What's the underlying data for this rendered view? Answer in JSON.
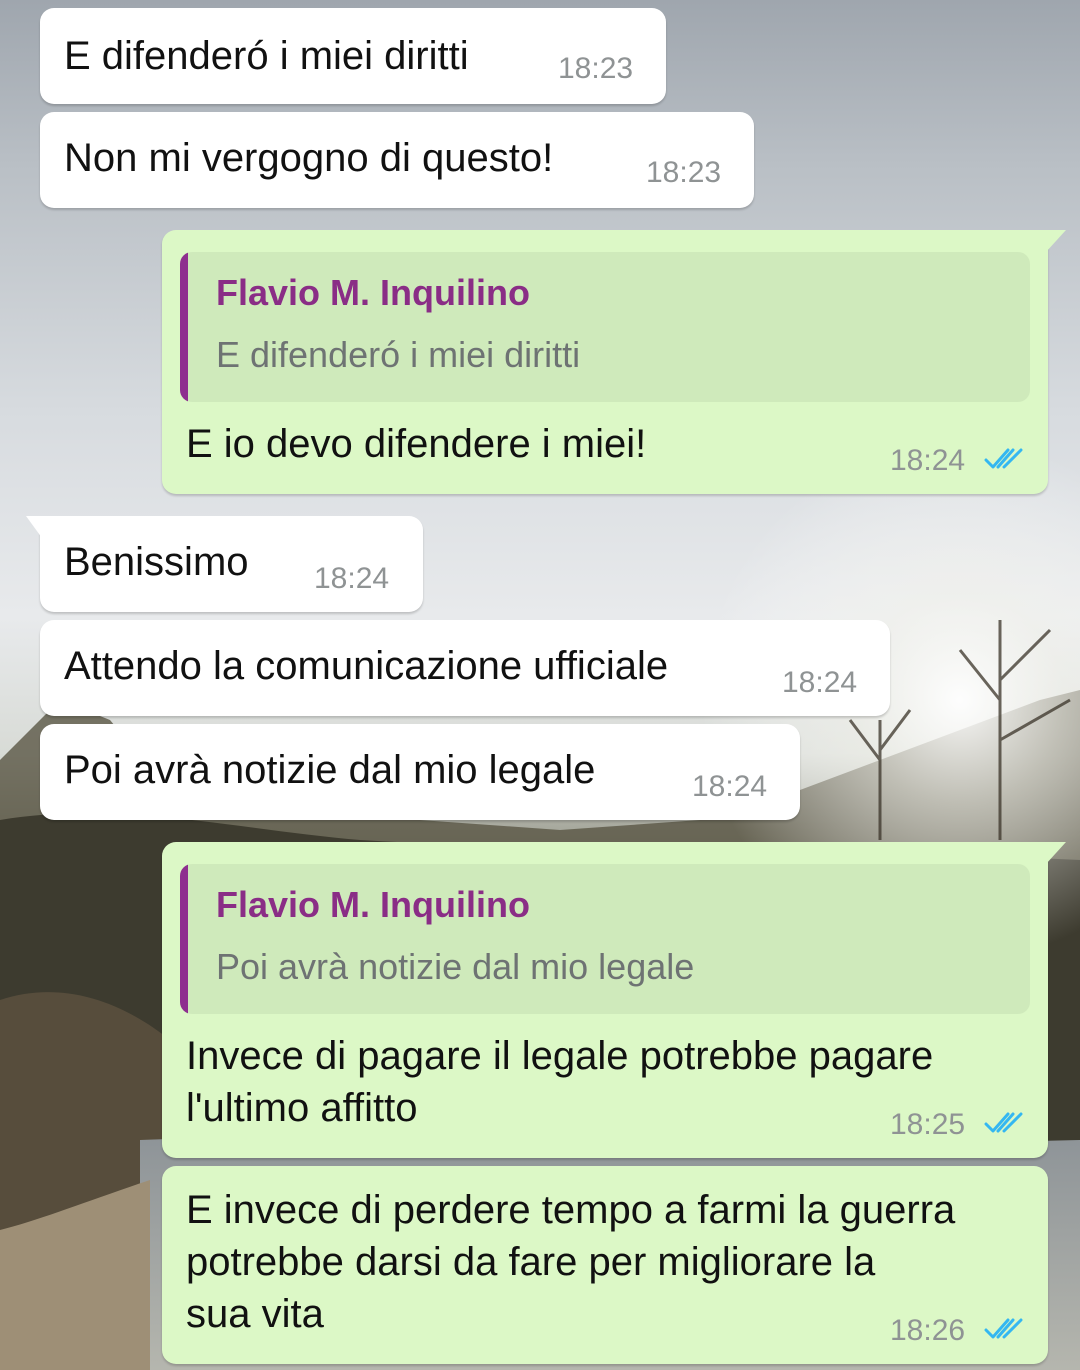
{
  "contact_name": "Flavio M. Inquilino",
  "colors": {
    "incoming_bubble": "#ffffff",
    "outgoing_bubble": "#dcf8c6",
    "quote_bar": "#8e2f8f",
    "quote_name": "#8a2d86",
    "read_ticks": "#34b7f1"
  },
  "messages": [
    {
      "direction": "incoming",
      "text": "E difenderó i miei diritti",
      "time": "18:23"
    },
    {
      "direction": "incoming",
      "text": "Non mi vergogno di questo!",
      "time": "18:23"
    },
    {
      "direction": "outgoing",
      "quote_author": "Flavio M. Inquilino",
      "quote_text": "E difenderó i miei diritti",
      "text": "E io devo difendere i miei!",
      "time": "18:24",
      "status_icon": "double-check-read-icon"
    },
    {
      "direction": "incoming",
      "text": "Benissimo",
      "time": "18:24"
    },
    {
      "direction": "incoming",
      "text": "Attendo la comunicazione ufficiale",
      "time": "18:24"
    },
    {
      "direction": "incoming",
      "text": "Poi avrà notizie dal mio legale",
      "time": "18:24"
    },
    {
      "direction": "outgoing",
      "quote_author": "Flavio M. Inquilino",
      "quote_text": "Poi avrà notizie dal mio legale",
      "text_lines": [
        "Invece di pagare il legale potrebbe pagare",
        "l'ultimo affitto"
      ],
      "time": "18:25",
      "status_icon": "double-check-read-icon"
    },
    {
      "direction": "outgoing",
      "text_lines": [
        "E invece di perdere tempo a farmi la guerra",
        "potrebbe darsi da fare per migliorare la",
        "sua vita"
      ],
      "time": "18:26",
      "status_icon": "double-check-read-icon"
    }
  ]
}
